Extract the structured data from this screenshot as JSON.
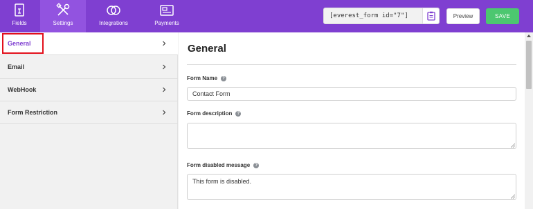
{
  "topbar": {
    "tabs": [
      {
        "label": "Fields",
        "icon": "fields-icon",
        "active": false
      },
      {
        "label": "Settings",
        "icon": "settings-icon",
        "active": true
      },
      {
        "label": "Integrations",
        "icon": "integrations-icon",
        "active": false
      },
      {
        "label": "Payments",
        "icon": "payments-icon",
        "active": false
      }
    ],
    "shortcode": "[everest_form id=\"7\"]",
    "preview_label": "Preview",
    "save_label": "SAVE"
  },
  "sidebar": {
    "items": [
      {
        "label": "General",
        "active": true
      },
      {
        "label": "Email",
        "active": false
      },
      {
        "label": "WebHook",
        "active": false
      },
      {
        "label": "Form Restriction",
        "active": false
      }
    ]
  },
  "main": {
    "title": "General",
    "fields": [
      {
        "label": "Form Name",
        "value": "Contact Form",
        "type": "text"
      },
      {
        "label": "Form description",
        "value": "",
        "type": "textarea"
      },
      {
        "label": "Form disabled message",
        "value": "This form is disabled.",
        "type": "textarea"
      }
    ]
  },
  "colors": {
    "topbar": "#7f3fd1",
    "accent": "#7f3fd1",
    "save": "#4cc770",
    "highlight": "#e20f1b"
  }
}
